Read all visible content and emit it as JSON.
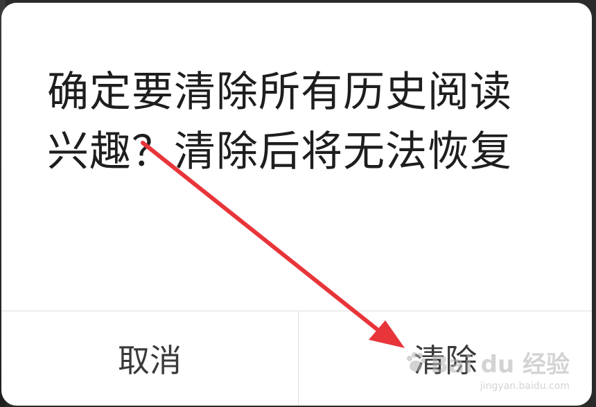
{
  "dialog": {
    "message": "确定要清除所有历史阅读兴趣？清除后将无法恢复",
    "cancel_label": "取消",
    "confirm_label": "清除"
  },
  "annotation": {
    "arrow_color": "#e8353a"
  },
  "watermark": {
    "brand": "Bai du 经验",
    "url": "jingyan.baidu.com"
  },
  "colors": {
    "dialog_bg": "#ffffff",
    "text": "#1e1e1e",
    "button_text": "#3a3a3a",
    "divider": "#dedede"
  }
}
